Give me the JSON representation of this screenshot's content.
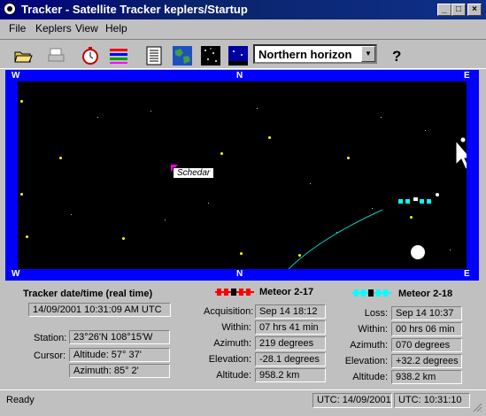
{
  "window": {
    "title": "Tracker - Satellite Tracker  keplers/Startup"
  },
  "menu": [
    "File",
    "Keplers",
    "View",
    "Help"
  ],
  "toolbar": {
    "icons": [
      "open-folder-icon",
      "print-icon",
      "stopwatch-icon",
      "palette-icon",
      "list-icon",
      "earth-map-icon",
      "star-field-icon",
      "horizon-view-icon",
      "help-icon"
    ],
    "view_selected": "Northern horizon"
  },
  "sky": {
    "top_labels": [
      "W",
      "N",
      "E"
    ],
    "bottom_labels": [
      "W",
      "N",
      "E"
    ],
    "star_name": "Schedar"
  },
  "tracker": {
    "heading": "Tracker date/time (real time)",
    "datetime": "14/09/2001 10:31:09 AM UTC",
    "station_label": "Station:",
    "station_value": "23°26'N   108°15'W",
    "cursor_label": "Cursor:",
    "cursor_altitude": "Altitude: 57° 37'",
    "cursor_azimuth": "Azimuth: 85° 2'"
  },
  "sat1": {
    "name": "Meteor 2-17",
    "color": "#ff0000",
    "rows": [
      {
        "label": "Acquisition:",
        "value": "Sep 14  18:12"
      },
      {
        "label": "Within:",
        "value": "07 hrs 41 min"
      },
      {
        "label": "Azimuth:",
        "value": "219 degrees"
      },
      {
        "label": "Elevation:",
        "value": "-28.1 degrees"
      },
      {
        "label": "Altitude:",
        "value": "958.2 km"
      }
    ]
  },
  "sat2": {
    "name": "Meteor 2-18",
    "color": "#00ffff",
    "rows": [
      {
        "label": "Loss:",
        "value": "Sep 14  10:37"
      },
      {
        "label": "Within:",
        "value": "00 hrs 06 min"
      },
      {
        "label": "Azimuth:",
        "value": "070 degrees"
      },
      {
        "label": "Elevation:",
        "value": "+32.2 degrees"
      },
      {
        "label": "Altitude:",
        "value": "938.2 km"
      }
    ]
  },
  "status": {
    "ready": "Ready",
    "utc_date": "UTC: 14/09/2001",
    "utc_time": "UTC: 10:31:10"
  }
}
